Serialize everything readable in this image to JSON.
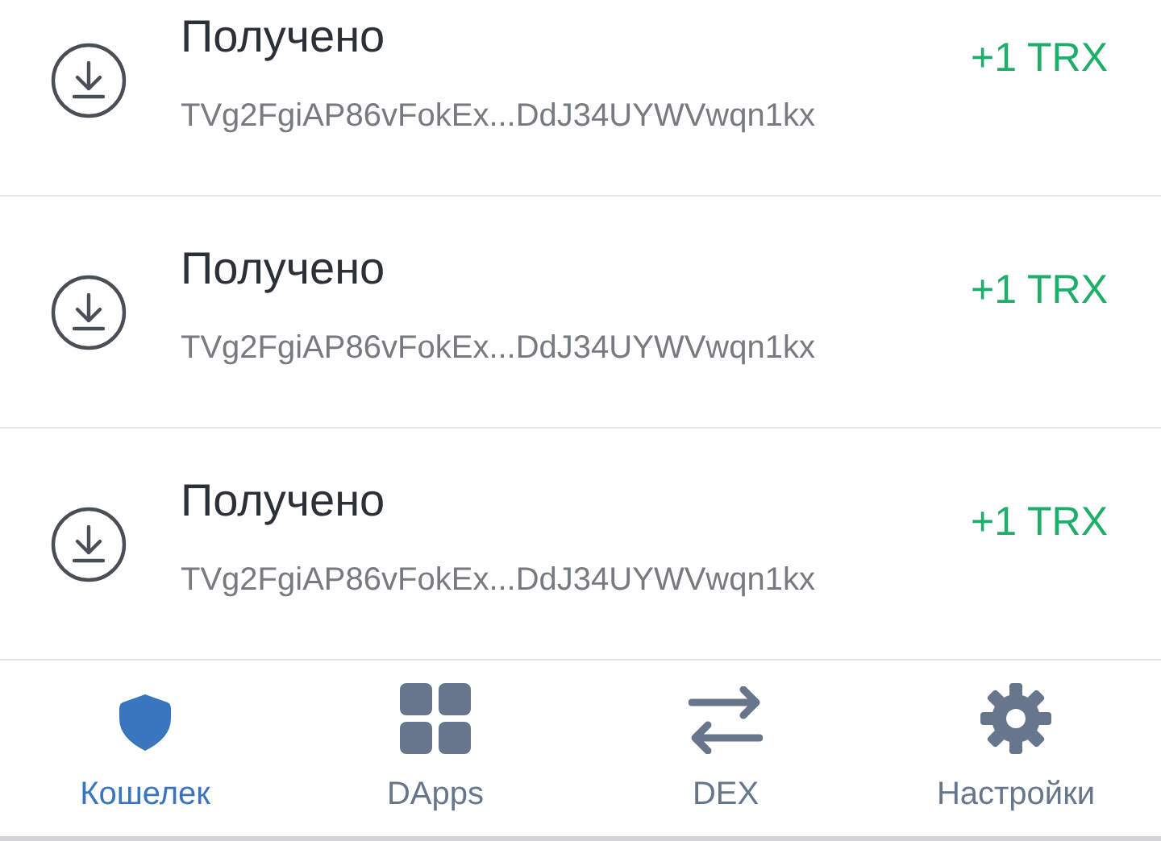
{
  "transactions": [
    {
      "title": "Получено",
      "address": "TVg2FgiAP86vFokEx...DdJ34UYWVwqn1kx",
      "amount": "+1 TRX"
    },
    {
      "title": "Получено",
      "address": "TVg2FgiAP86vFokEx...DdJ34UYWVwqn1kx",
      "amount": "+1 TRX"
    },
    {
      "title": "Получено",
      "address": "TVg2FgiAP86vFokEx...DdJ34UYWVwqn1kx",
      "amount": "+1 TRX"
    }
  ],
  "tabs": [
    {
      "label": "Кошелек",
      "kind": "wallet",
      "selected": true
    },
    {
      "label": "DApps",
      "kind": "apps",
      "selected": false
    },
    {
      "label": "DEX",
      "kind": "exchange",
      "selected": false
    },
    {
      "label": "Настройки",
      "kind": "settings",
      "selected": false
    }
  ]
}
